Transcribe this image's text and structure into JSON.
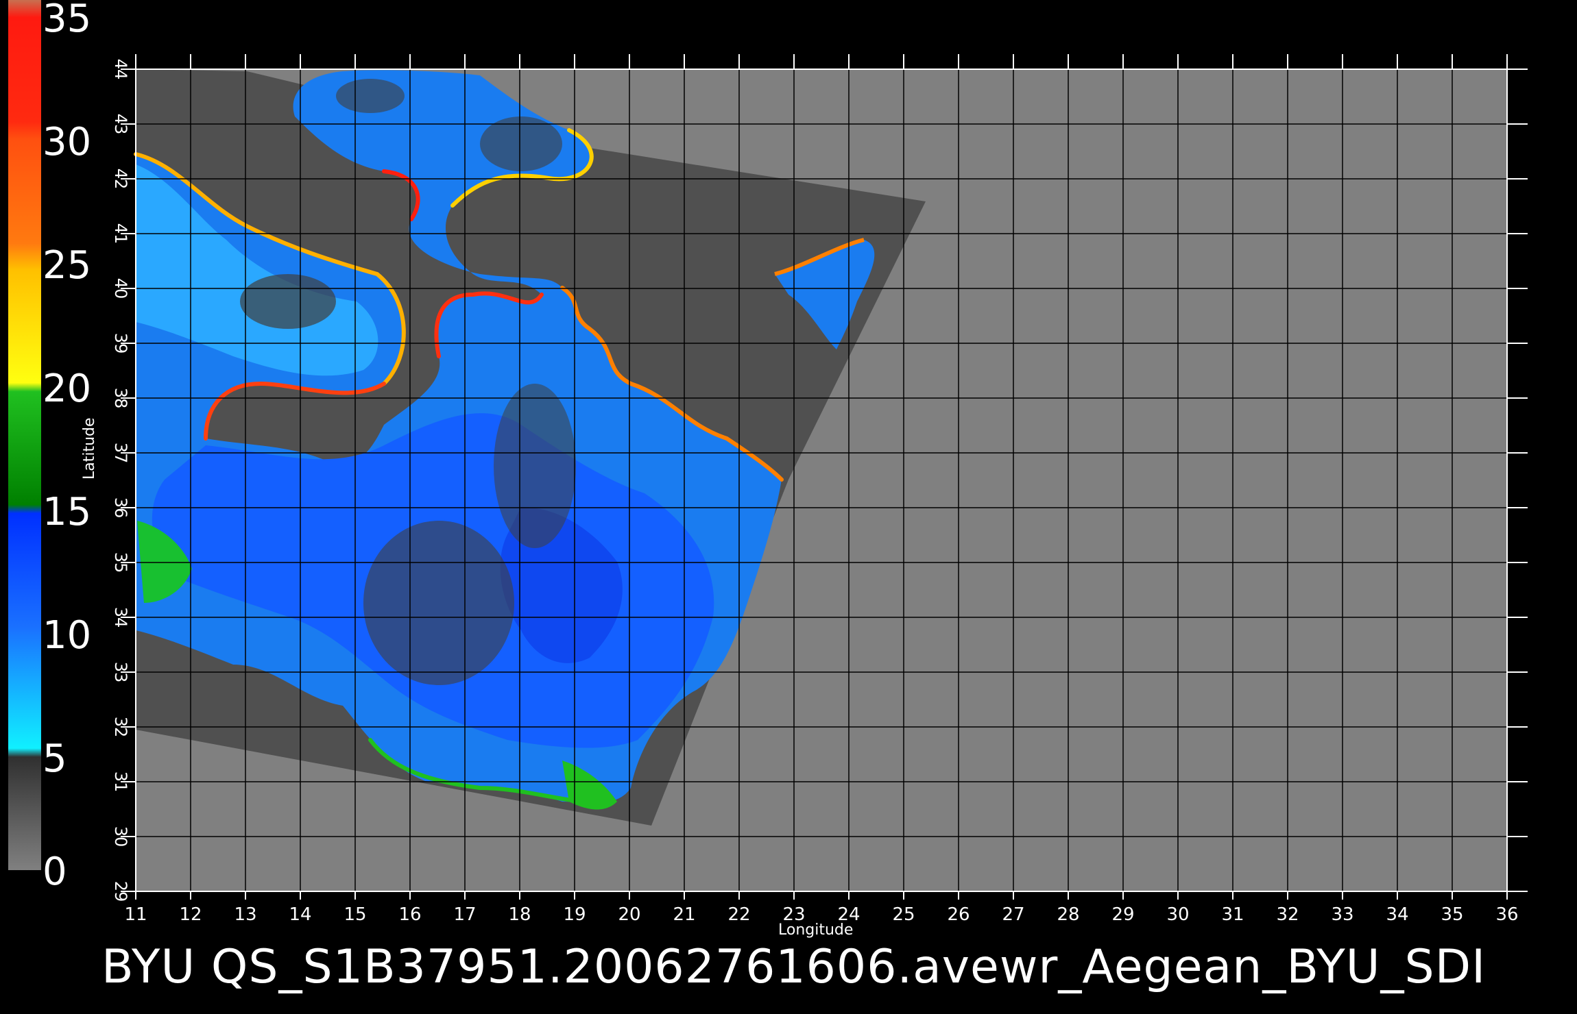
{
  "colorbar": {
    "ticks": [
      "35",
      "30",
      "25",
      "20",
      "15",
      "10",
      "5",
      "0"
    ],
    "segments": [
      "#c87050",
      "#ff1a10",
      "#ff6a10",
      "#ffd800",
      "#10b010",
      "#1040ff",
      "#10e8ff",
      "#4a4a4a"
    ]
  },
  "axes": {
    "xlabel": "Longitude",
    "ylabel": "Latitude",
    "xticks": [
      "11",
      "12",
      "13",
      "14",
      "15",
      "16",
      "17",
      "18",
      "19",
      "20",
      "21",
      "22",
      "23",
      "24",
      "25",
      "26",
      "27",
      "28",
      "29",
      "30",
      "31",
      "32",
      "33",
      "34",
      "35",
      "36"
    ],
    "yticks": [
      "29",
      "30",
      "31",
      "32",
      "33",
      "34",
      "35",
      "36",
      "37",
      "38",
      "39",
      "40",
      "41",
      "42",
      "43",
      "44"
    ]
  },
  "colors": {
    "background": "#000000",
    "out_of_swath": "#808080",
    "land_in_swath": "#505050",
    "ocean": "#1e8cff",
    "grid": "#000000"
  },
  "footer": {
    "title": "BYU  QS_S1B37951.20062761606.avewr_Aegean_BYU_SDI"
  }
}
